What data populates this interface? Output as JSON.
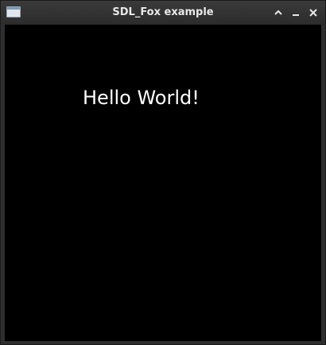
{
  "window": {
    "title": "SDL_Fox example",
    "icons": {
      "app": "window-app-icon",
      "maximize": "chevron-up-icon",
      "minimize": "minimize-icon",
      "close": "close-icon"
    },
    "colors": {
      "titlebar": "#333333",
      "title_text": "#e8e8e8",
      "canvas": "#000000"
    }
  },
  "canvas": {
    "text": "Hello World!",
    "text_color": "#ffffff"
  }
}
